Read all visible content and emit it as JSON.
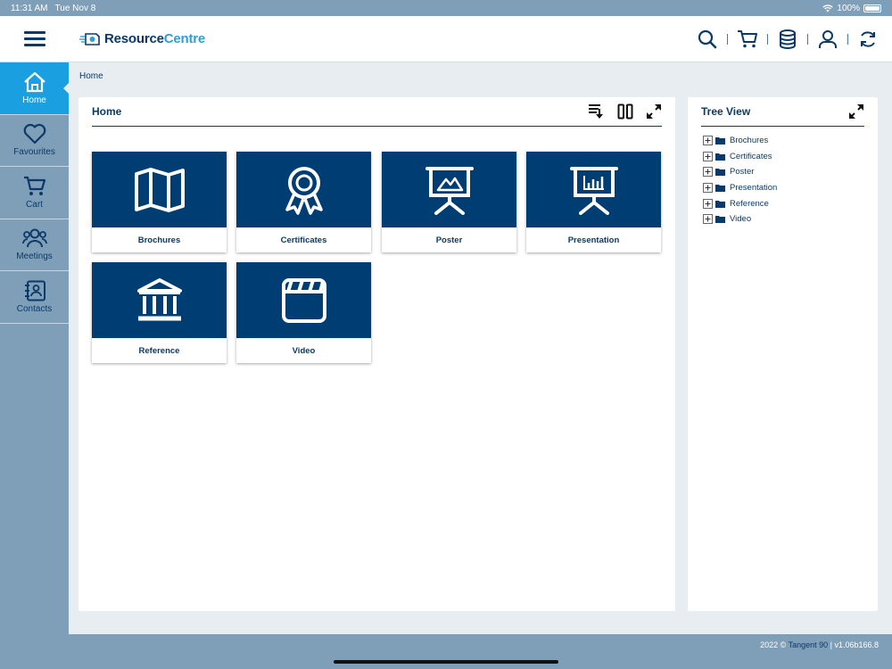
{
  "statusbar": {
    "time": "11:31 AM",
    "date": "Tue Nov 8",
    "battery": "100%"
  },
  "header": {
    "logo_main": "Resource",
    "logo_accent": "Centre"
  },
  "sidebar": {
    "items": [
      {
        "label": "Home",
        "icon": "home-icon",
        "active": true
      },
      {
        "label": "Favourites",
        "icon": "heart-icon",
        "active": false
      },
      {
        "label": "Cart",
        "icon": "cart-icon",
        "active": false
      },
      {
        "label": "Meetings",
        "icon": "people-icon",
        "active": false
      },
      {
        "label": "Contacts",
        "icon": "contacts-icon",
        "active": false
      }
    ]
  },
  "breadcrumb": "Home",
  "home_panel": {
    "title": "Home",
    "tiles": [
      {
        "label": "Brochures",
        "icon": "map-icon"
      },
      {
        "label": "Certificates",
        "icon": "award-icon"
      },
      {
        "label": "Poster",
        "icon": "presentation-image-icon"
      },
      {
        "label": "Presentation",
        "icon": "presentation-chart-icon"
      },
      {
        "label": "Reference",
        "icon": "library-icon"
      },
      {
        "label": "Video",
        "icon": "video-clip-icon"
      }
    ]
  },
  "tree_panel": {
    "title": "Tree View",
    "items": [
      "Brochures",
      "Certificates",
      "Poster",
      "Presentation",
      "Reference",
      "Video"
    ]
  },
  "footer": {
    "prefix": "2022 © ",
    "link": "Tangent 90",
    "suffix": " | v1.06b166.8"
  },
  "colors": {
    "brand": "#0b3a68",
    "active": "#1a9fe0",
    "tile": "#003d73",
    "chrome": "#7f9eb8",
    "logo_accent": "#2d9fd8"
  }
}
